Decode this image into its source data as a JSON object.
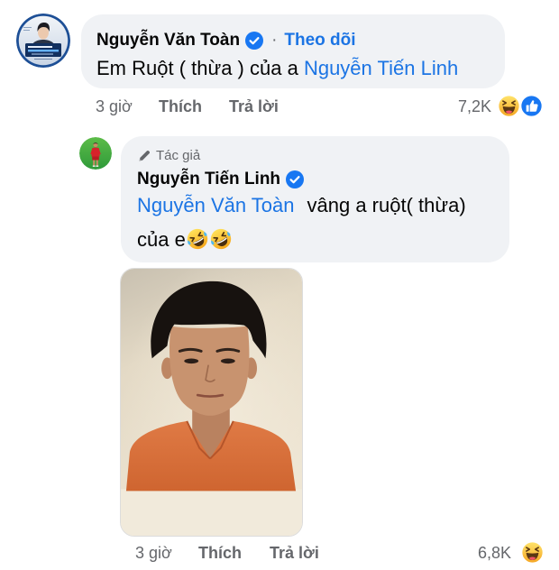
{
  "colors": {
    "text": "#050505",
    "meta_gray": "#65676b",
    "link_blue": "#1b74e4",
    "bubble_bg": "#f0f2f5",
    "verified_blue": "#1877f2"
  },
  "comment": {
    "author": "Nguyễn Văn Toàn",
    "verified_icon": "verified-badge-icon",
    "separator": "·",
    "follow_label": "Theo dõi",
    "text": "Em Ruột ( thừa ) của a",
    "mention": "Nguyễn Tiến Linh",
    "time": "3 giờ",
    "like_label": "Thích",
    "reply_label": "Trả lời",
    "reaction_count": "7,2K",
    "reaction_icons": [
      "haha-icon",
      "like-icon"
    ]
  },
  "reply": {
    "role_icon": "pen-icon",
    "role_label": "Tác giả",
    "author": "Nguyễn Tiến Linh",
    "verified_icon": "verified-badge-icon",
    "mention": "Nguyễn Văn Toàn",
    "text_line1": "vâng a ruột( thừa)",
    "text_line2": "của e",
    "inline_emojis": [
      "rolling-on-floor-laughing-icon",
      "rolling-on-floor-laughing-icon"
    ],
    "time": "3 giờ",
    "like_label": "Thích",
    "reply_label": "Trả lời",
    "reaction_count": "6,8K",
    "reaction_icons": [
      "haha-icon"
    ]
  }
}
